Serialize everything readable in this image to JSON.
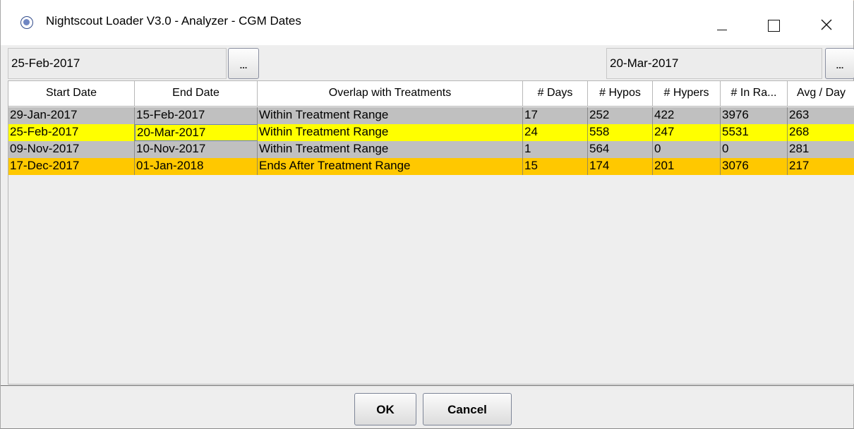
{
  "window": {
    "title": "Nightscout Loader V3.0 - Analyzer - CGM Dates",
    "controls": {
      "minimize": "minimize-icon",
      "maximize": "maximize-icon",
      "close": "close-icon"
    }
  },
  "date_range": {
    "start_date": "25-Feb-2017",
    "end_date": "20-Mar-2017",
    "picker_label": "..."
  },
  "table": {
    "columns": [
      "Start Date",
      "End Date",
      "Overlap with Treatments",
      "# Days",
      "# Hypos",
      "# Hypers",
      "# In Ra...",
      "Avg / Day"
    ],
    "rows": [
      {
        "start": "29-Jan-2017",
        "end": "15-Feb-2017",
        "overlap": "Within Treatment Range",
        "days": "17",
        "hypos": "252",
        "hypers": "422",
        "in_range": "3976",
        "avg": "263",
        "color": "#c0c0c0"
      },
      {
        "start": "25-Feb-2017",
        "end": "20-Mar-2017",
        "overlap": "Within Treatment Range",
        "days": "24",
        "hypos": "558",
        "hypers": "247",
        "in_range": "5531",
        "avg": "268",
        "color": "#ffff00"
      },
      {
        "start": "09-Nov-2017",
        "end": "10-Nov-2017",
        "overlap": "Within Treatment Range",
        "days": "1",
        "hypos": "564",
        "hypers": "0",
        "in_range": "0",
        "avg": "281",
        "color": "#c0c0c0"
      },
      {
        "start": "17-Dec-2017",
        "end": "01-Jan-2018",
        "overlap": "Ends After Treatment Range",
        "days": "15",
        "hypos": "174",
        "hypers": "201",
        "in_range": "3076",
        "avg": "217",
        "color": "#ffc800"
      }
    ]
  },
  "buttons": {
    "ok": "OK",
    "cancel": "Cancel"
  }
}
